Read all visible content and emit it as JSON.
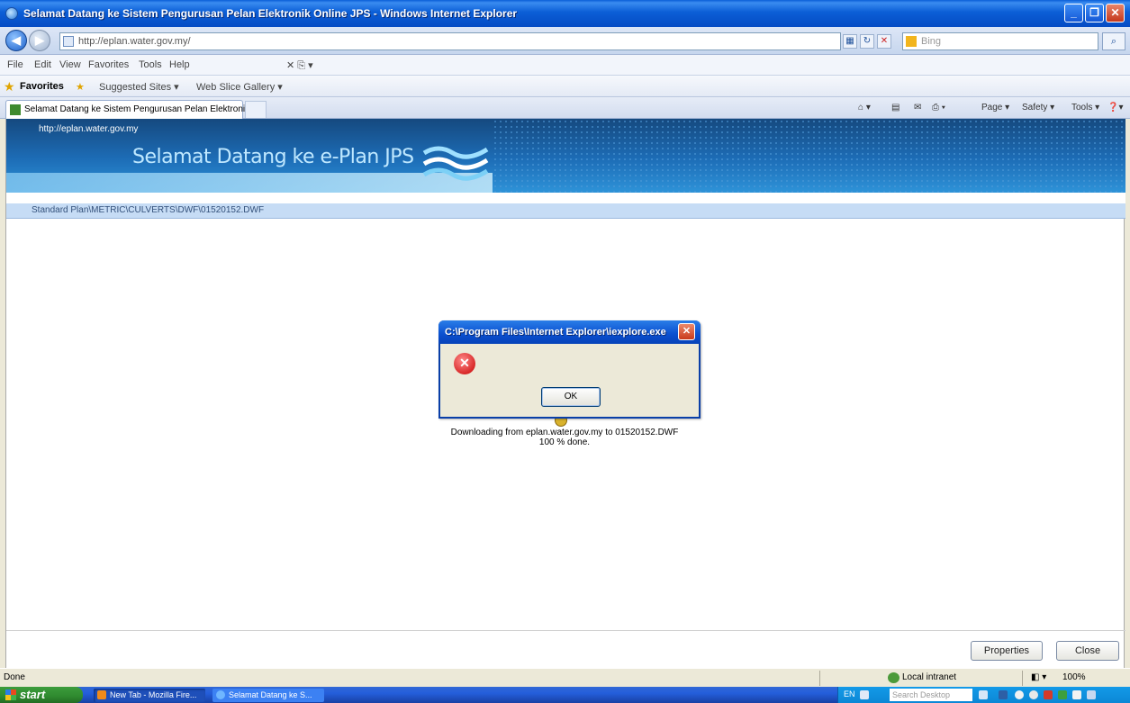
{
  "window": {
    "title": "Selamat Datang ke Sistem Pengurusan Pelan Elektronik Online JPS - Windows Internet Explorer"
  },
  "address": {
    "url": "http://eplan.water.gov.my/",
    "search_placeholder": "Bing"
  },
  "menu": [
    "File",
    "Edit",
    "View",
    "Favorites",
    "Tools",
    "Help"
  ],
  "favorites": {
    "label": "Favorites",
    "items": [
      "Suggested Sites ▾",
      "Web Slice Gallery ▾"
    ]
  },
  "tab": {
    "title": "Selamat Datang ke Sistem Pengurusan Pelan Elektroni..."
  },
  "commands": [
    "Page ▾",
    "Safety ▾",
    "Tools ▾"
  ],
  "banner": {
    "site_url": "http://eplan.water.gov.my",
    "welcome": "Selamat Datang ke e-Plan JPS"
  },
  "breadcrumb": "Standard Plan\\METRIC\\CULVERTS\\DWF\\01520152.DWF",
  "download": {
    "line1": "Downloading from eplan.water.gov.my to 01520152.DWF",
    "line2": "100 % done."
  },
  "dialog": {
    "title": "C:\\Program Files\\Internet Explorer\\iexplore.exe",
    "ok_label": "OK"
  },
  "buttons": {
    "properties": "Properties",
    "close": "Close"
  },
  "status": {
    "text": "Done",
    "zone": "Local intranet",
    "zoom": "100%"
  },
  "taskbar": {
    "start_label": "start",
    "tasks": [
      "New Tab - Mozilla Fire...",
      "Selamat Datang ke S..."
    ],
    "search_placeholder": "Search Desktop"
  }
}
